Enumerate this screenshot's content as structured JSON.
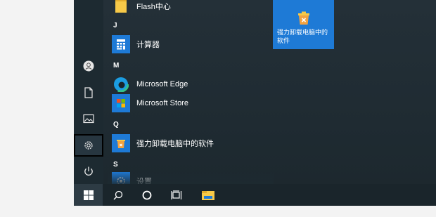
{
  "start_menu": {
    "apps": [
      {
        "letter": "",
        "label": "Flash中心",
        "icon": "folder-icon"
      },
      {
        "letter": "J",
        "label": "计算器",
        "icon": "calculator-icon"
      },
      {
        "letter": "M",
        "label": "Microsoft Edge",
        "icon": "edge-icon"
      },
      {
        "letter": "",
        "label": "Microsoft Store",
        "icon": "store-icon"
      },
      {
        "letter": "Q",
        "label": "强力卸载电脑中的软件",
        "icon": "uninstaller-icon"
      },
      {
        "letter": "S",
        "label": "设置",
        "icon": "settings-icon"
      }
    ],
    "tile": {
      "label": "强力卸载电脑中的软件",
      "color": "#1e7ad6"
    }
  },
  "rail": [
    "user-icon",
    "document-icon",
    "pictures-icon",
    "settings-icon",
    "power-icon"
  ],
  "taskbar": [
    "windows-start-icon",
    "search-icon",
    "cortana-icon",
    "task-view-icon",
    "file-explorer-icon"
  ]
}
